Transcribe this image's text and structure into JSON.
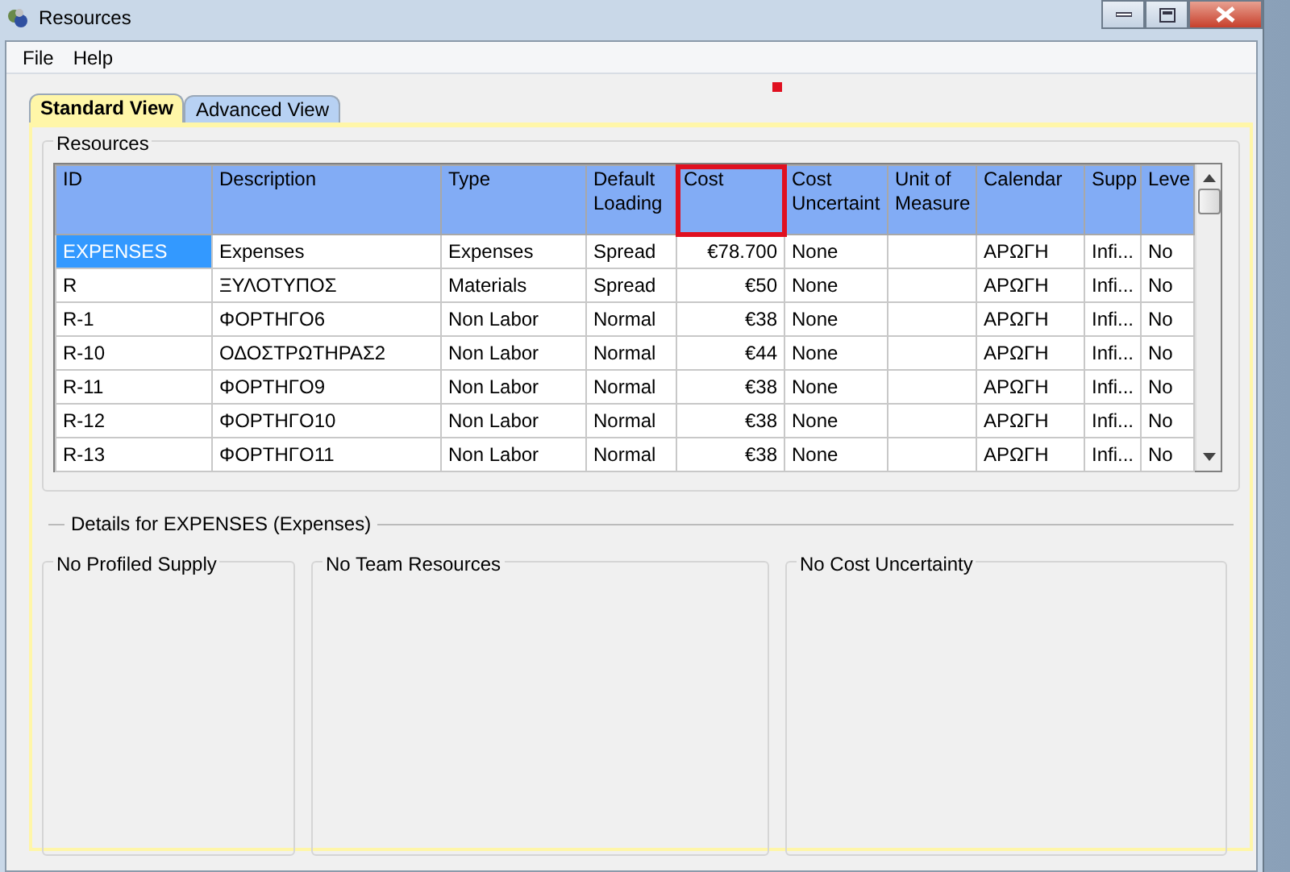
{
  "window": {
    "title": "Resources"
  },
  "menu": [
    "File",
    "Help"
  ],
  "tabs": [
    {
      "label": "Standard View",
      "selected": true
    },
    {
      "label": "Advanced View",
      "selected": false
    }
  ],
  "resources": {
    "title": "Resources",
    "columns": [
      {
        "label": "ID",
        "highlighted": false
      },
      {
        "label": "Description",
        "highlighted": false
      },
      {
        "label": "Type",
        "highlighted": false
      },
      {
        "label": "Default Loading",
        "highlighted": false
      },
      {
        "label": "Cost",
        "highlighted": true
      },
      {
        "label": "Cost Uncertaint",
        "highlighted": false
      },
      {
        "label": "Unit of Measure",
        "highlighted": false
      },
      {
        "label": "Calendar",
        "highlighted": false
      },
      {
        "label": "Supp",
        "highlighted": false
      },
      {
        "label": "Leve",
        "highlighted": false
      }
    ],
    "rows": [
      {
        "selected": true,
        "cells": [
          "EXPENSES",
          "Expenses",
          "Expenses",
          "Spread",
          "€78.700",
          "None",
          "",
          "ΑΡΩΓΗ",
          "Infi...",
          "No"
        ]
      },
      {
        "selected": false,
        "cells": [
          "R",
          "ΞΥΛΟΤΥΠΟΣ",
          "Materials",
          "Spread",
          "€50",
          "None",
          "",
          "ΑΡΩΓΗ",
          "Infi...",
          "No"
        ]
      },
      {
        "selected": false,
        "cells": [
          "R-1",
          "ΦΟΡΤΗΓΟ6",
          "Non Labor",
          "Normal",
          "€38",
          "None",
          "",
          "ΑΡΩΓΗ",
          "Infi...",
          "No"
        ]
      },
      {
        "selected": false,
        "cells": [
          "R-10",
          "ΟΔΟΣΤΡΩΤΗΡΑΣ2",
          "Non Labor",
          "Normal",
          "€44",
          "None",
          "",
          "ΑΡΩΓΗ",
          "Infi...",
          "No"
        ]
      },
      {
        "selected": false,
        "cells": [
          "R-11",
          "ΦΟΡΤΗΓΟ9",
          "Non Labor",
          "Normal",
          "€38",
          "None",
          "",
          "ΑΡΩΓΗ",
          "Infi...",
          "No"
        ]
      },
      {
        "selected": false,
        "cells": [
          "R-12",
          "ΦΟΡΤΗΓΟ10",
          "Non Labor",
          "Normal",
          "€38",
          "None",
          "",
          "ΑΡΩΓΗ",
          "Infi...",
          "No"
        ]
      },
      {
        "selected": false,
        "cells": [
          "R-13",
          "ΦΟΡΤΗΓΟ11",
          "Non Labor",
          "Normal",
          "€38",
          "None",
          "",
          "ΑΡΩΓΗ",
          "Infi...",
          "No"
        ]
      }
    ]
  },
  "details": {
    "title": "Details for EXPENSES (Expenses)",
    "panels": [
      "No Profiled Supply",
      "No Team Resources",
      "No Cost Uncertainty"
    ]
  }
}
